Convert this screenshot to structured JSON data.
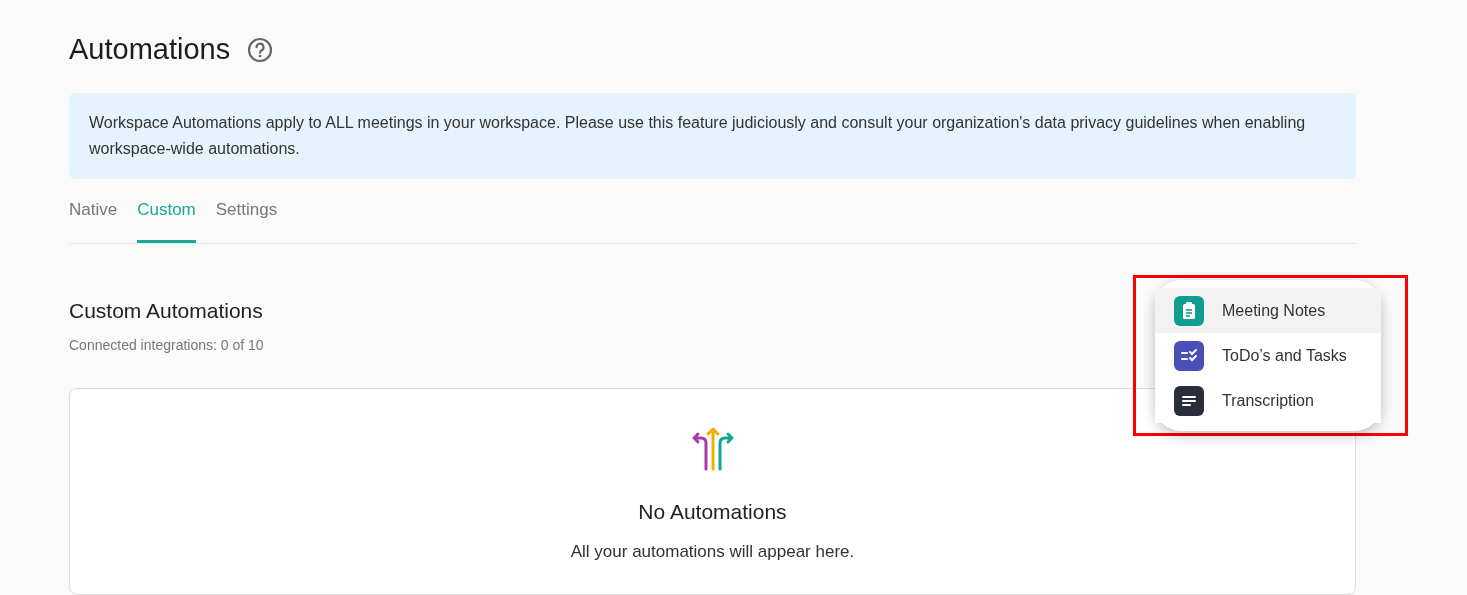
{
  "page": {
    "title": "Automations"
  },
  "notice": "Workspace Automations apply to ALL meetings in your workspace. Please use this feature judiciously and consult your organization's data privacy guidelines when enabling workspace-wide automations.",
  "tabs": [
    {
      "label": "Native",
      "selected": false
    },
    {
      "label": "Custom",
      "selected": true
    },
    {
      "label": "Settings",
      "selected": false
    }
  ],
  "section": {
    "title": "Custom Automations",
    "subtitle": "Connected integrations: 0 of 10"
  },
  "empty_state": {
    "title": "No Automations",
    "message": "All your automations will appear here."
  },
  "menu": {
    "items": [
      {
        "kind": "notes",
        "label": "Meeting Notes",
        "selected": true,
        "color": "#0e9e8f"
      },
      {
        "kind": "tasks",
        "label": "ToDo’s and Tasks",
        "selected": false,
        "color": "#4a4fb8"
      },
      {
        "kind": "transcript",
        "label": "Transcription",
        "selected": false,
        "color": "#2a2e3b"
      }
    ]
  }
}
